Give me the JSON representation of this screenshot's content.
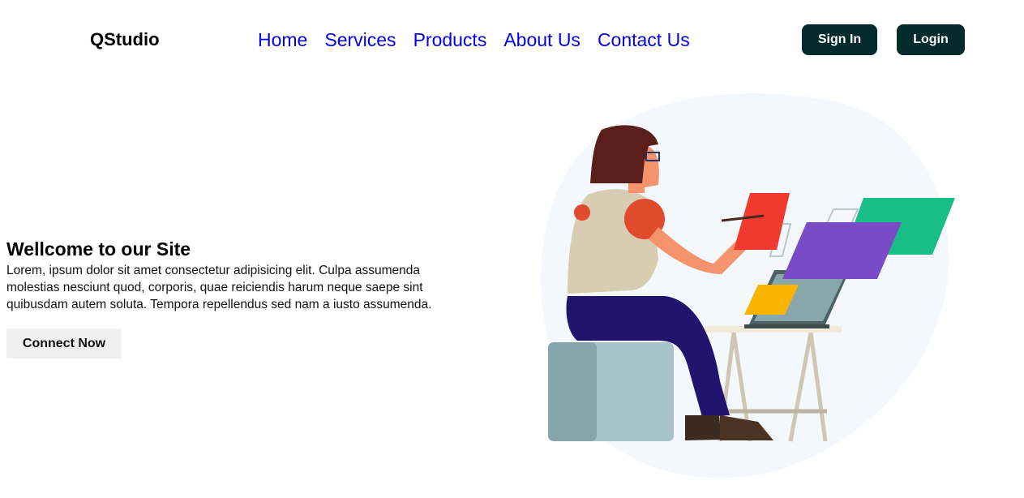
{
  "header": {
    "brand": "QStudio",
    "nav": [
      "Home",
      "Services",
      "Products",
      "About Us",
      "Contact Us"
    ],
    "signin_label": "Sign In",
    "login_label": "Login"
  },
  "hero": {
    "title": "Wellcome to our Site",
    "body": "Lorem, ipsum dolor sit amet consectetur adipisicing elit. Culpa assumenda molestias nesciunt quod, corporis, quae reiciendis harum neque saepe sint quibusdam autem soluta. Tempora repellendus sed nam a iusto assumenda.",
    "cta_label": "Connect Now"
  },
  "colors": {
    "button_dark": "#032b2c",
    "link": "#0000ee",
    "cta_bg": "#efefef"
  }
}
